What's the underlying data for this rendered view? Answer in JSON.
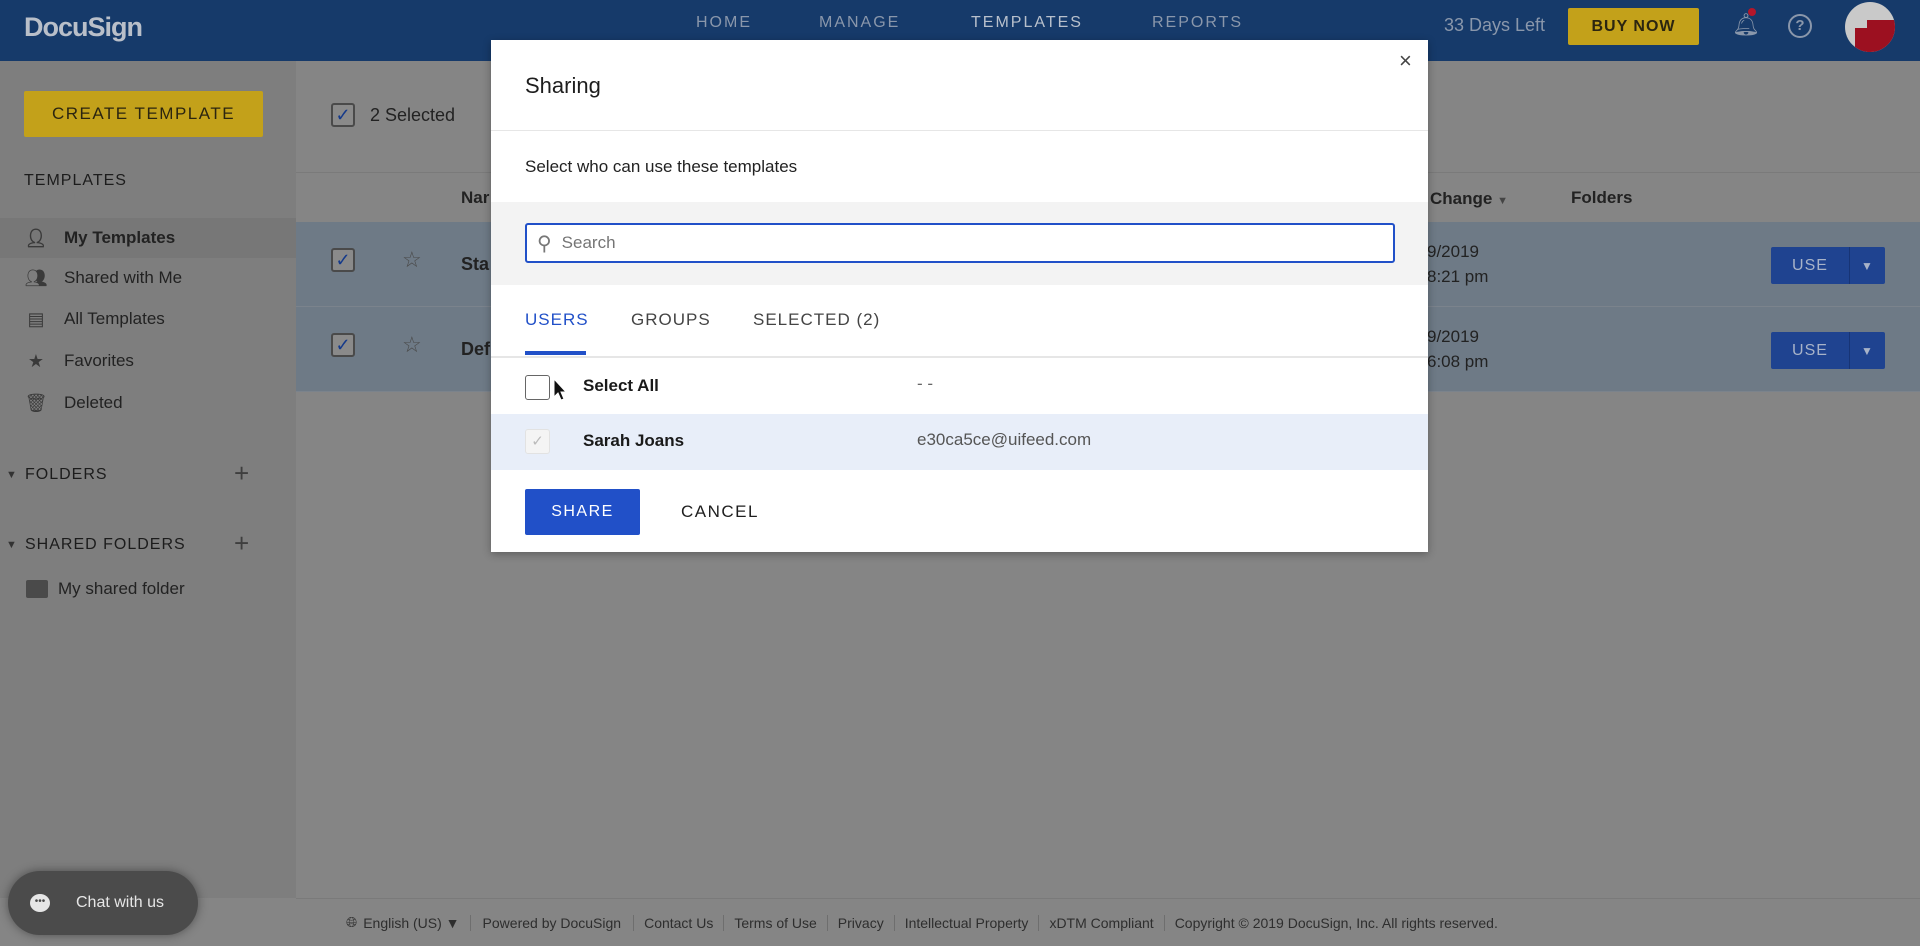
{
  "header": {
    "logo": "DocuSign",
    "nav": [
      "HOME",
      "MANAGE",
      "TEMPLATES",
      "REPORTS"
    ],
    "active_nav": "TEMPLATES",
    "trial": "33 Days Left",
    "buy_now": "BUY NOW"
  },
  "sidebar": {
    "create_button": "CREATE TEMPLATE",
    "templates_heading": "TEMPLATES",
    "items": [
      {
        "label": "My Templates",
        "icon": "person-icon"
      },
      {
        "label": "Shared with Me",
        "icon": "people-icon"
      },
      {
        "label": "All Templates",
        "icon": "layout-icon"
      },
      {
        "label": "Favorites",
        "icon": "star-icon"
      },
      {
        "label": "Deleted",
        "icon": "trash-icon"
      }
    ],
    "folders_heading": "FOLDERS",
    "shared_folders_heading": "SHARED FOLDERS",
    "shared_folders": [
      "My shared folder"
    ]
  },
  "main": {
    "selected_count": "2 Selected",
    "columns": {
      "name": "Nar",
      "change": "Change",
      "folders": "Folders"
    },
    "rows": [
      {
        "name": "Sta",
        "date": "9/2019",
        "time": "8:21 pm",
        "use": "USE"
      },
      {
        "name": "Def",
        "date": "9/2019",
        "time": "6:08 pm",
        "use": "USE"
      }
    ]
  },
  "modal": {
    "title": "Sharing",
    "subtitle": "Select who can use these templates",
    "search_placeholder": "Search",
    "tabs": [
      "USERS",
      "GROUPS",
      "SELECTED (2)"
    ],
    "active_tab": "USERS",
    "select_all": "Select All",
    "select_all_email": "- -",
    "users": [
      {
        "name": "Sarah Joans",
        "email": "e30ca5ce@uifeed.com",
        "checked": true
      }
    ],
    "share": "SHARE",
    "cancel": "CANCEL"
  },
  "footer": {
    "language": "English (US)",
    "links": [
      "Powered by DocuSign",
      "Contact Us",
      "Terms of Use",
      "Privacy",
      "Intellectual Property",
      "xDTM Compliant"
    ],
    "copyright": "Copyright © 2019 DocuSign, Inc. All rights reserved."
  },
  "chat": {
    "label": "Chat with us"
  },
  "colors": {
    "brand": "#1e4ca1",
    "accent_yellow": "#ffcc22",
    "primary_button": "#2150c8"
  }
}
